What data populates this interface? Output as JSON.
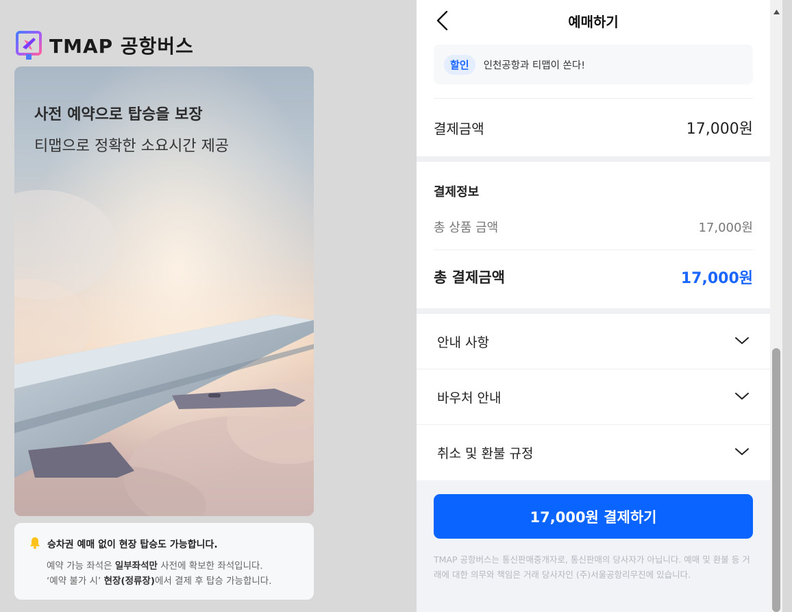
{
  "brand": {
    "name": "TMAP 공항버스"
  },
  "hero": {
    "title": "사전 예약으로 탑승을 보장",
    "subtitle": "티맵으로 정확한 소요시간 제공"
  },
  "notice": {
    "headline": "승차권 예매 없이 현장 탑승도 가능합니다.",
    "line1_pre": "예약 가능 좌석은 ",
    "line1_bold": "일부좌석만",
    "line1_post": " 사전에 확보한 좌석입니다.",
    "line2_pre": "‘예약 불가 시’ ",
    "line2_bold": "현장(정류장)",
    "line2_post": "에서 결제 후 탑승 가능합니다."
  },
  "panel": {
    "title": "예매하기",
    "promo": {
      "chip": "할인",
      "text": "인천공항과 티맵이 쏜다!"
    },
    "amount": {
      "label": "결제금액",
      "value": "17,000원"
    },
    "payment_info": {
      "title": "결제정보",
      "goods_label": "총 상품 금액",
      "goods_value": "17,000원",
      "total_label": "총 결제금액",
      "total_value": "17,000원"
    },
    "accordions": [
      {
        "label": "안내 사항"
      },
      {
        "label": "바우처 안내"
      },
      {
        "label": "취소 및 환불 규정"
      }
    ],
    "pay_button": "17,000원 결제하기",
    "legal": "TMAP 공항버스는 통신판매중개자로, 통신판매의 당사자가 아닙니다. 예매 및 환불 등 거래에 대한 의무와 책임은 거래 당사자인 (주)서울공항리무진에 있습니다."
  },
  "colors": {
    "accent": "#0a64ff",
    "chip_bg": "#e4eeff",
    "page_bg": "#d9d9d9"
  },
  "icons": [
    "plane-logo-icon",
    "bell-icon",
    "back-arrow-icon",
    "chevron-down-icon",
    "scroll-up-arrow-icon"
  ]
}
